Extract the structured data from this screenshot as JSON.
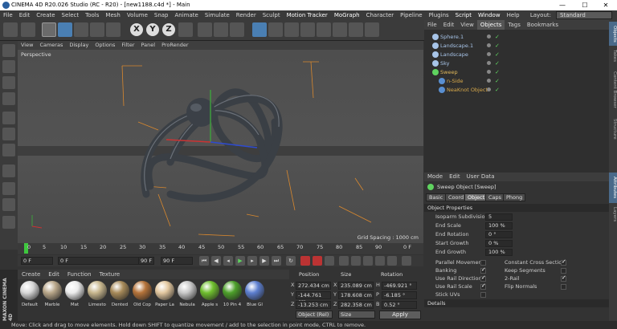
{
  "titlebar": {
    "title": "CINEMA 4D R20.026 Studio (RC - R20) - [new1188.c4d *] - Main",
    "min": "—",
    "max": "☐",
    "close": "✕"
  },
  "menubar": {
    "items": [
      "File",
      "Edit",
      "Create",
      "Select",
      "Tools",
      "Mesh",
      "Volume",
      "Snap",
      "Animate",
      "Simulate",
      "Render",
      "Sculpt",
      "Motion Tracker",
      "MoGraph",
      "Character",
      "Pipeline",
      "Plugins",
      "Script",
      "Window",
      "Help"
    ],
    "layout_label": "Layout:",
    "layout_value": "Standard"
  },
  "viewport": {
    "menu": [
      "View",
      "Cameras",
      "Display",
      "Options",
      "Filter",
      "Panel",
      "ProRender"
    ],
    "label": "Perspective",
    "grid_spacing": "Grid Spacing : 1000 cm"
  },
  "timeline": {
    "ticks": [
      "0",
      "5",
      "10",
      "15",
      "20",
      "25",
      "30",
      "35",
      "40",
      "45",
      "50",
      "55",
      "60",
      "65",
      "70",
      "75",
      "80",
      "85",
      "90"
    ],
    "end_tick": "0 F",
    "start_field": "0 F",
    "cur_field": "0 F",
    "end_field": "90 F",
    "max_field": "90 F"
  },
  "materials": {
    "menu": [
      "Create",
      "Edit",
      "Function",
      "Texture"
    ],
    "items": [
      {
        "name": "Default",
        "color": "#d8d8d8"
      },
      {
        "name": "Marble",
        "color": "#b9a78a"
      },
      {
        "name": "Mat",
        "color": "#ececec"
      },
      {
        "name": "Limesto",
        "color": "#c8b78e"
      },
      {
        "name": "Dented",
        "color": "#a88b5a"
      },
      {
        "name": "Old Cop",
        "color": "#b5733a"
      },
      {
        "name": "Paper La",
        "color": "#e3c8a0"
      },
      {
        "name": "Nebula",
        "color": "#c9c9c9"
      },
      {
        "name": "Apple s",
        "color": "#6fbf2e"
      },
      {
        "name": "10 Pin 4",
        "color": "#4da02a"
      },
      {
        "name": "Blue Gl",
        "color": "#5d7fd0"
      }
    ]
  },
  "coordinates": {
    "headers": [
      "Position",
      "Size",
      "Rotation"
    ],
    "rows": [
      {
        "axis": "X",
        "pos": "272.434 cm",
        "size_axis": "X",
        "size": "235.089 cm",
        "rot_axis": "H",
        "rot": "-469.921 °"
      },
      {
        "axis": "Y",
        "pos": "-144.761 cm",
        "size_axis": "Y",
        "size": "178.608 cm",
        "rot_axis": "P",
        "rot": "-6.185 °"
      },
      {
        "axis": "Z",
        "pos": "-13.253 cm",
        "size_axis": "Z",
        "size": "282.358 cm",
        "rot_axis": "B",
        "rot": "0.52 °"
      }
    ],
    "mode": "Object (Rel)",
    "size_mode": "Size",
    "apply": "Apply"
  },
  "object_manager": {
    "menu": [
      "File",
      "Edit",
      "View",
      "Objects",
      "Tags",
      "Bookmarks"
    ],
    "objects": [
      {
        "name": "Sphere.1",
        "indent": 0,
        "color": "#a7c4e8",
        "selected": false
      },
      {
        "name": "Landscape.1",
        "indent": 0,
        "color": "#a7c4e8",
        "selected": false
      },
      {
        "name": "Landscape",
        "indent": 0,
        "color": "#a7c4e8",
        "selected": false
      },
      {
        "name": "Sky",
        "indent": 0,
        "color": "#a7c4e8",
        "selected": false
      },
      {
        "name": "Sweep",
        "indent": 0,
        "color": "#d7a84a",
        "selected": true
      },
      {
        "name": "n-Side",
        "indent": 1,
        "color": "#d7a84a",
        "selected": true
      },
      {
        "name": "NeaKnot Object",
        "indent": 1,
        "color": "#d7a84a",
        "selected": true
      }
    ]
  },
  "attribute_manager": {
    "menu": [
      "Mode",
      "Edit",
      "User Data"
    ],
    "title": "Sweep Object [Sweep]",
    "tabs": [
      "Basic",
      "Coord",
      "Object",
      "Caps",
      "Phong"
    ],
    "active_tab": "Object",
    "section": "Object Properties",
    "props": [
      {
        "label": "Isoparm Subdivision",
        "value": "5"
      },
      {
        "label": "End Scale",
        "value": "100 %"
      },
      {
        "label": "End Rotation",
        "value": "0 °"
      },
      {
        "label": "Start Growth",
        "value": "0 %"
      },
      {
        "label": "End Growth",
        "value": "100 %"
      }
    ],
    "checks_left": [
      {
        "label": "Parallel Movement",
        "on": false
      },
      {
        "label": "Banking",
        "on": true
      },
      {
        "label": "Use Rail Direction",
        "on": true
      },
      {
        "label": "Use Rail Scale",
        "on": true
      },
      {
        "label": "Stick UVs",
        "on": false
      }
    ],
    "checks_right": [
      {
        "label": "Constant Cross Section",
        "on": true
      },
      {
        "label": "Keep Segments",
        "on": false
      },
      {
        "label": "2-Rail",
        "on": true
      },
      {
        "label": "Flip Normals",
        "on": false
      }
    ],
    "details": "Details"
  },
  "sidestrip": [
    "Objects",
    "Takes",
    "Content Browser",
    "Structure",
    "Attributes",
    "Layers"
  ],
  "status": "Move: Click and drag to move elements. Hold down SHIFT to quantize movement / add to the selection in point mode, CTRL to remove.",
  "maxon": "MAXON CINEMA 4D"
}
